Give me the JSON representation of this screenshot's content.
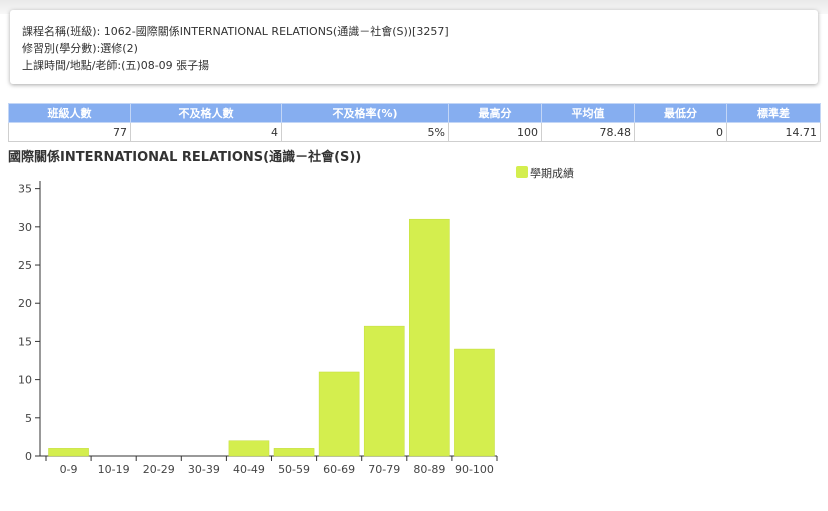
{
  "course": {
    "name_line": "課程名稱(班級): 1062-國際關係INTERNATIONAL RELATIONS(通識－社會(S))[3257]",
    "type_line": "修習別(學分數):選修(2)",
    "time_line": "上課時間/地點/老師:(五)08-09 張子揚"
  },
  "stats": {
    "headers": [
      "班級人數",
      "不及格人數",
      "不及格率(%)",
      "最高分",
      "平均值",
      "最低分",
      "標準差"
    ],
    "values": [
      "77",
      "4",
      "5%",
      "100",
      "78.48",
      "0",
      "14.71"
    ]
  },
  "colors": {
    "bar": "#d4ee4e",
    "bar_stroke": "#c2dc3a",
    "header_bg": "#86aef0"
  },
  "chart_data": {
    "type": "bar",
    "title": "國際關係INTERNATIONAL RELATIONS(通識－社會(S))",
    "categories": [
      "0-9",
      "10-19",
      "20-29",
      "30-39",
      "40-49",
      "50-59",
      "60-69",
      "70-79",
      "80-89",
      "90-100"
    ],
    "series": [
      {
        "name": "學期成績",
        "values": [
          1,
          0,
          0,
          0,
          2,
          1,
          11,
          17,
          31,
          14
        ]
      }
    ],
    "xlabel": "",
    "ylabel": "",
    "ylim": [
      0,
      36
    ],
    "yticks": [
      0,
      5,
      10,
      15,
      20,
      25,
      30,
      35
    ],
    "grid": false,
    "legend": "top-right"
  }
}
